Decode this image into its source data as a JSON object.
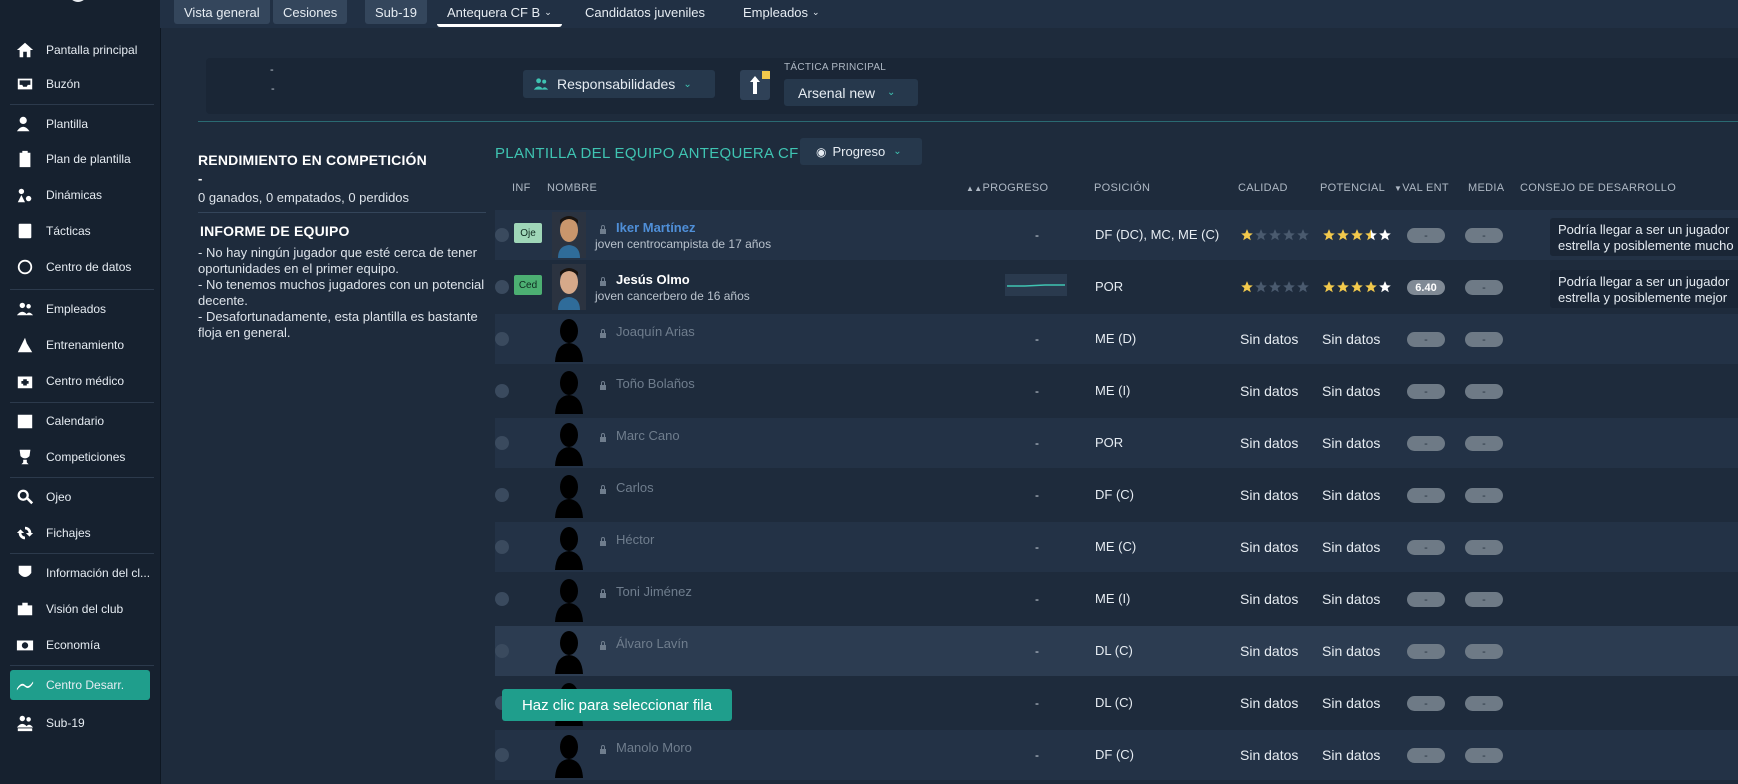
{
  "sidebar": {
    "items": [
      {
        "label": "Pantalla principal",
        "icon": "home-icon"
      },
      {
        "label": "Buzón",
        "icon": "inbox-icon"
      },
      {
        "label": "Plantilla",
        "icon": "squad-icon"
      },
      {
        "label": "Plan de plantilla",
        "icon": "clipboard-icon"
      },
      {
        "label": "Dinámicas",
        "icon": "dynamics-icon"
      },
      {
        "label": "Tácticas",
        "icon": "tactics-icon"
      },
      {
        "label": "Centro de datos",
        "icon": "data-center-icon"
      },
      {
        "label": "Empleados",
        "icon": "staff-icon"
      },
      {
        "label": "Entrenamiento",
        "icon": "training-icon"
      },
      {
        "label": "Centro médico",
        "icon": "medical-icon"
      },
      {
        "label": "Calendario",
        "icon": "calendar-icon"
      },
      {
        "label": "Competiciones",
        "icon": "trophy-icon"
      },
      {
        "label": "Ojeo",
        "icon": "scouting-icon"
      },
      {
        "label": "Fichajes",
        "icon": "transfers-icon"
      },
      {
        "label": "Información del cl...",
        "icon": "club-info-icon"
      },
      {
        "label": "Visión del club",
        "icon": "club-vision-icon"
      },
      {
        "label": "Economía",
        "icon": "finance-icon"
      },
      {
        "label": "Centro Desarr.",
        "icon": "development-icon"
      },
      {
        "label": "Sub-19",
        "icon": "u19-icon"
      }
    ]
  },
  "tabs": [
    "Vista general",
    "Cesiones",
    "Sub-19",
    "Antequera CF B",
    "Candidatos juveniles",
    "Empleados"
  ],
  "infobar": {
    "dash1": "-",
    "dash2": "-",
    "responsibilities": "Responsabilidades",
    "tactic_label": "TÁCTICA PRINCIPAL",
    "tactic_value": "Arsenal new"
  },
  "left": {
    "perf_title": "RENDIMIENTO EN COMPETICIÓN",
    "perf_dash": "-",
    "perf_record": "0 ganados, 0 empatados, 0 perdidos",
    "report_title": "INFORME DE EQUIPO",
    "report_lines": [
      "- No hay ningún jugador que esté cerca de tener oportunidades en el primer equipo.",
      "- No tenemos muchos jugadores con un potencial decente.",
      "- Desafortunadamente, esta plantilla es bastante floja en general."
    ]
  },
  "squad": {
    "title": "PLANTILLA DEL EQUIPO ANTEQUERA CF B",
    "view_button": "Progreso",
    "columns": {
      "inf": "INF",
      "nombre": "NOMBRE",
      "progreso": "PROGRESO",
      "posicion": "POSICIÓN",
      "calidad": "CALIDAD",
      "potencial": "POTENCIAL",
      "valent": "VAL ENT",
      "media": "MEDIA",
      "consejo": "CONSEJO DE DESARROLLO"
    },
    "rows": [
      {
        "inf": "Oje",
        "name": "Iker Martínez",
        "sub": "joven centrocampista de 17 años",
        "progress": "-",
        "pos": "DF (DC), MC, ME (C)",
        "cal_stars": 1,
        "pot_stars": 3.5,
        "val": "-",
        "med": "-",
        "advice1": "Podría llegar a ser un jugador",
        "advice2": "estrella y posiblemente mucho"
      },
      {
        "inf": "Ced",
        "name": "Jesús Olmo",
        "sub": "joven cancerbero de 16 años",
        "progress": "",
        "pos": "POR",
        "cal_stars": 1,
        "pot_stars": 4,
        "val": "6.40",
        "med": "-",
        "advice1": "Podría llegar a ser un jugador",
        "advice2": "estrella y posiblemente mejor"
      },
      {
        "name": "Joaquín Arias",
        "progress": "-",
        "pos": "ME (D)",
        "cal": "Sin datos",
        "pot": "Sin datos",
        "val": "-",
        "med": "-"
      },
      {
        "name": "Toño Bolaños",
        "progress": "-",
        "pos": "ME (I)",
        "cal": "Sin datos",
        "pot": "Sin datos",
        "val": "-",
        "med": "-"
      },
      {
        "name": "Marc Cano",
        "progress": "-",
        "pos": "POR",
        "cal": "Sin datos",
        "pot": "Sin datos",
        "val": "-",
        "med": "-"
      },
      {
        "name": "Carlos",
        "progress": "-",
        "pos": "DF (C)",
        "cal": "Sin datos",
        "pot": "Sin datos",
        "val": "-",
        "med": "-"
      },
      {
        "name": "Héctor",
        "progress": "-",
        "pos": "ME (C)",
        "cal": "Sin datos",
        "pot": "Sin datos",
        "val": "-",
        "med": "-"
      },
      {
        "name": "Toni Jiménez",
        "progress": "-",
        "pos": "ME (I)",
        "cal": "Sin datos",
        "pot": "Sin datos",
        "val": "-",
        "med": "-"
      },
      {
        "name": "Álvaro Lavín",
        "progress": "-",
        "pos": "DL (C)",
        "cal": "Sin datos",
        "pot": "Sin datos",
        "val": "-",
        "med": "-"
      },
      {
        "name": "",
        "progress": "-",
        "pos": "DL (C)",
        "cal": "Sin datos",
        "pot": "Sin datos",
        "val": "-",
        "med": "-"
      },
      {
        "name": "Manolo Moro",
        "progress": "-",
        "pos": "DF (C)",
        "cal": "Sin datos",
        "pot": "Sin datos",
        "val": "-",
        "med": "-"
      }
    ]
  },
  "tooltip": "Haz clic para seleccionar fila",
  "colors": {
    "accent": "#1f9e8c",
    "title_teal": "#3fc4b2",
    "star": "#f2c94c",
    "bg": "#1e2b3c",
    "sidebar": "#16212f"
  }
}
